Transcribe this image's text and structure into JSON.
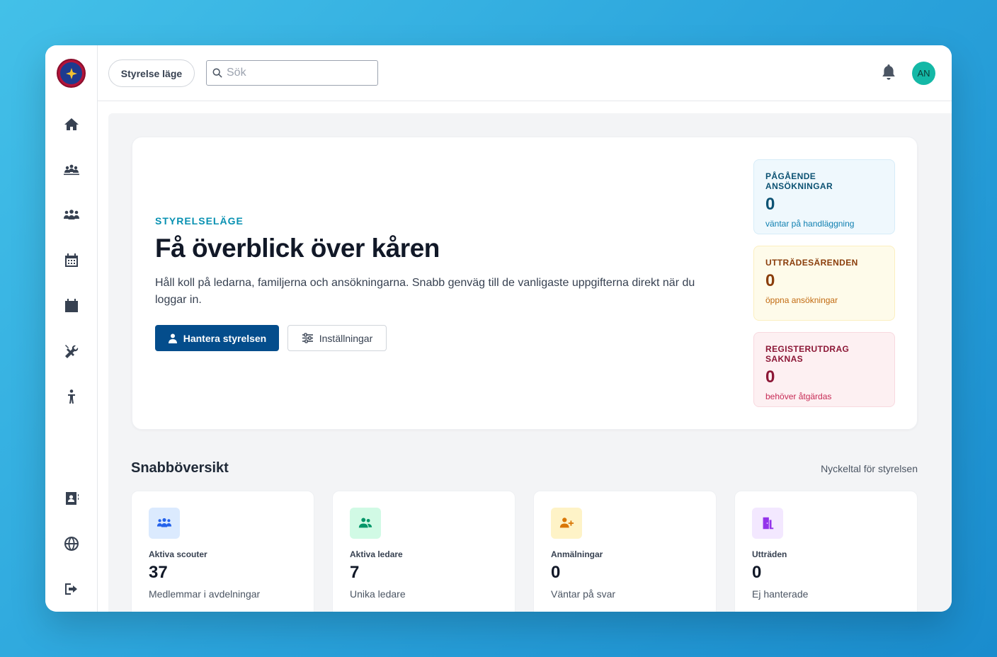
{
  "topbar": {
    "mode_button": "Styrelse läge",
    "search_placeholder": "Sök",
    "avatar_initials": "AN"
  },
  "sidebar": {
    "items": [
      {
        "icon": "home-icon"
      },
      {
        "icon": "groups-icon"
      },
      {
        "icon": "members-icon"
      },
      {
        "icon": "calendar-grid-icon"
      },
      {
        "icon": "calendar-icon"
      },
      {
        "icon": "tools-icon"
      },
      {
        "icon": "child-icon"
      },
      {
        "icon": "contact-book-icon"
      },
      {
        "icon": "globe-icon"
      },
      {
        "icon": "logout-icon"
      }
    ]
  },
  "hero": {
    "eyebrow": "STYRELSELÄGE",
    "title": "Få överblick över kåren",
    "description": "Håll koll på ledarna, familjerna och ansökningarna. Snabb genväg till de vanligaste uppgifterna direkt när du loggar in.",
    "primary_button": "Hantera styrelsen",
    "secondary_button": "Inställningar"
  },
  "stats": [
    {
      "label": "PÅGÅENDE ANSÖKNINGAR",
      "value": "0",
      "sub": "väntar på handläggning",
      "color": "#0c5273"
    },
    {
      "label": "UTTRÄDESÄRENDEN",
      "value": "0",
      "sub": "öppna ansökningar",
      "color": "#8a3d0b"
    },
    {
      "label": "REGISTERUTDRAG SAKNAS",
      "value": "0",
      "sub": "behöver åtgärdas",
      "color": "#8c1736"
    }
  ],
  "overview": {
    "title": "Snabböversikt",
    "subtitle": "Nyckeltal för styrelsen",
    "cards": [
      {
        "label": "Aktiva scouter",
        "value": "37",
        "sub": "Medlemmar i avdelningar",
        "icon": "scouts-icon",
        "accent": "#2563eb"
      },
      {
        "label": "Aktiva ledare",
        "value": "7",
        "sub": "Unika ledare",
        "icon": "leaders-icon",
        "accent": "#059669"
      },
      {
        "label": "Anmälningar",
        "value": "0",
        "sub": "Väntar på svar",
        "icon": "user-plus-icon",
        "accent": "#d97706"
      },
      {
        "label": "Utträden",
        "value": "0",
        "sub": "Ej hanterade",
        "icon": "door-exit-icon",
        "accent": "#9333ea"
      }
    ]
  }
}
